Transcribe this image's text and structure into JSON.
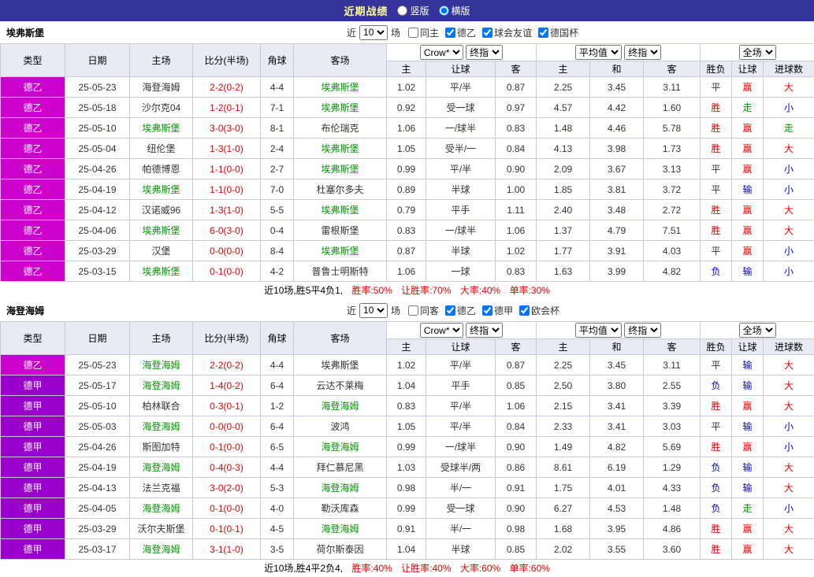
{
  "colors": {
    "red": "#e60000",
    "blue": "#0000cc",
    "green": "#009900",
    "dark": "#333333",
    "focus_team": "#009900",
    "score": "#e60000",
    "topbar_bg": "#333399",
    "header_bg": "#eaeaf5"
  },
  "league_colors": {
    "德乙": "#cc00cc",
    "德甲": "#9900cc"
  },
  "topbar": {
    "title": "近期战绩",
    "views": [
      {
        "label": "竖版",
        "selected": false
      },
      {
        "label": "横版",
        "selected": true
      }
    ]
  },
  "columns": {
    "left": [
      "类型",
      "日期",
      "主场",
      "比分(半场)",
      "角球",
      "客场"
    ],
    "selects": {
      "bookmaker": "Crow*",
      "final_a": "终指",
      "average": "平均值",
      "final_b": "终指",
      "full": "全场"
    },
    "sub": [
      "主",
      "让球",
      "客",
      "主",
      "和",
      "客",
      "胜负",
      "让球",
      "进球数"
    ]
  },
  "sections": [
    {
      "team": "埃弗斯堡",
      "filter": {
        "prefix": "近",
        "count": "10",
        "suffix": "场",
        "checkboxes": [
          {
            "label": "同主",
            "checked": false
          },
          {
            "label": "德乙",
            "checked": true
          },
          {
            "label": "球会友谊",
            "checked": true
          },
          {
            "label": "德国杯",
            "checked": true
          }
        ]
      },
      "rows": [
        {
          "league": "德乙",
          "date": "25-05-23",
          "home": "海登海姆",
          "home_focus": false,
          "score": "2-2(0-2)",
          "corner": "4-4",
          "away": "埃弗斯堡",
          "away_focus": true,
          "odds": [
            "1.02",
            "平/半",
            "0.87"
          ],
          "avg": [
            "2.25",
            "3.45",
            "3.11"
          ],
          "results": [
            [
              "平",
              "dark"
            ],
            [
              "赢",
              "red"
            ],
            [
              "大",
              "red"
            ]
          ]
        },
        {
          "league": "德乙",
          "date": "25-05-18",
          "home": "沙尔克04",
          "home_focus": false,
          "score": "1-2(0-1)",
          "corner": "7-1",
          "away": "埃弗斯堡",
          "away_focus": true,
          "odds": [
            "0.92",
            "受一球",
            "0.97"
          ],
          "avg": [
            "4.57",
            "4.42",
            "1.60"
          ],
          "results": [
            [
              "胜",
              "red"
            ],
            [
              "走",
              "green"
            ],
            [
              "小",
              "blue"
            ]
          ]
        },
        {
          "league": "德乙",
          "date": "25-05-10",
          "home": "埃弗斯堡",
          "home_focus": true,
          "score": "3-0(3-0)",
          "corner": "8-1",
          "away": "布伦瑞克",
          "away_focus": false,
          "odds": [
            "1.06",
            "一/球半",
            "0.83"
          ],
          "avg": [
            "1.48",
            "4.46",
            "5.78"
          ],
          "results": [
            [
              "胜",
              "red"
            ],
            [
              "赢",
              "red"
            ],
            [
              "走",
              "green"
            ]
          ]
        },
        {
          "league": "德乙",
          "date": "25-05-04",
          "home": "纽伦堡",
          "home_focus": false,
          "score": "1-3(1-0)",
          "corner": "2-4",
          "away": "埃弗斯堡",
          "away_focus": true,
          "odds": [
            "1.05",
            "受半/一",
            "0.84"
          ],
          "avg": [
            "4.13",
            "3.98",
            "1.73"
          ],
          "results": [
            [
              "胜",
              "red"
            ],
            [
              "赢",
              "red"
            ],
            [
              "大",
              "red"
            ]
          ]
        },
        {
          "league": "德乙",
          "date": "25-04-26",
          "home": "帕德博恩",
          "home_focus": false,
          "score": "1-1(0-0)",
          "corner": "2-7",
          "away": "埃弗斯堡",
          "away_focus": true,
          "odds": [
            "0.99",
            "平/半",
            "0.90"
          ],
          "avg": [
            "2.09",
            "3.67",
            "3.13"
          ],
          "results": [
            [
              "平",
              "dark"
            ],
            [
              "赢",
              "red"
            ],
            [
              "小",
              "blue"
            ]
          ]
        },
        {
          "league": "德乙",
          "date": "25-04-19",
          "home": "埃弗斯堡",
          "home_focus": true,
          "score": "1-1(0-0)",
          "corner": "7-0",
          "away": "杜塞尔多夫",
          "away_focus": false,
          "odds": [
            "0.89",
            "半球",
            "1.00"
          ],
          "avg": [
            "1.85",
            "3.81",
            "3.72"
          ],
          "results": [
            [
              "平",
              "dark"
            ],
            [
              "输",
              "blue"
            ],
            [
              "小",
              "blue"
            ]
          ]
        },
        {
          "league": "德乙",
          "date": "25-04-12",
          "home": "汉诺威96",
          "home_focus": false,
          "score": "1-3(1-0)",
          "corner": "5-5",
          "away": "埃弗斯堡",
          "away_focus": true,
          "odds": [
            "0.79",
            "平手",
            "1.11"
          ],
          "avg": [
            "2.40",
            "3.48",
            "2.72"
          ],
          "results": [
            [
              "胜",
              "red"
            ],
            [
              "赢",
              "red"
            ],
            [
              "大",
              "red"
            ]
          ]
        },
        {
          "league": "德乙",
          "date": "25-04-06",
          "home": "埃弗斯堡",
          "home_focus": true,
          "score": "6-0(3-0)",
          "corner": "0-4",
          "away": "雷根斯堡",
          "away_focus": false,
          "odds": [
            "0.83",
            "一/球半",
            "1.06"
          ],
          "avg": [
            "1.37",
            "4.79",
            "7.51"
          ],
          "results": [
            [
              "胜",
              "red"
            ],
            [
              "赢",
              "red"
            ],
            [
              "大",
              "red"
            ]
          ]
        },
        {
          "league": "德乙",
          "date": "25-03-29",
          "home": "汉堡",
          "home_focus": false,
          "score": "0-0(0-0)",
          "corner": "8-4",
          "away": "埃弗斯堡",
          "away_focus": true,
          "odds": [
            "0.87",
            "半球",
            "1.02"
          ],
          "avg": [
            "1.77",
            "3.91",
            "4.03"
          ],
          "results": [
            [
              "平",
              "dark"
            ],
            [
              "赢",
              "red"
            ],
            [
              "小",
              "blue"
            ]
          ]
        },
        {
          "league": "德乙",
          "date": "25-03-15",
          "home": "埃弗斯堡",
          "home_focus": true,
          "score": "0-1(0-0)",
          "corner": "4-2",
          "away": "普鲁士明斯特",
          "away_focus": false,
          "odds": [
            "1.06",
            "一球",
            "0.83"
          ],
          "avg": [
            "1.63",
            "3.99",
            "4.82"
          ],
          "results": [
            [
              "负",
              "blue"
            ],
            [
              "输",
              "blue"
            ],
            [
              "小",
              "blue"
            ]
          ]
        }
      ],
      "summary": {
        "prefix": "近10场,胜5平4负1,",
        "stats": [
          "胜率:50%",
          "让胜率:70%",
          "大率:40%",
          "单率:30%"
        ]
      }
    },
    {
      "team": "海登海姆",
      "filter": {
        "prefix": "近",
        "count": "10",
        "suffix": "场",
        "checkboxes": [
          {
            "label": "同客",
            "checked": false
          },
          {
            "label": "德乙",
            "checked": true
          },
          {
            "label": "德甲",
            "checked": true
          },
          {
            "label": "欧会杯",
            "checked": true
          }
        ]
      },
      "rows": [
        {
          "league": "德乙",
          "date": "25-05-23",
          "home": "海登海姆",
          "home_focus": true,
          "score": "2-2(0-2)",
          "corner": "4-4",
          "away": "埃弗斯堡",
          "away_focus": false,
          "odds": [
            "1.02",
            "平/半",
            "0.87"
          ],
          "avg": [
            "2.25",
            "3.45",
            "3.11"
          ],
          "results": [
            [
              "平",
              "dark"
            ],
            [
              "输",
              "blue"
            ],
            [
              "大",
              "red"
            ]
          ]
        },
        {
          "league": "德甲",
          "date": "25-05-17",
          "home": "海登海姆",
          "home_focus": true,
          "score": "1-4(0-2)",
          "corner": "6-4",
          "away": "云达不莱梅",
          "away_focus": false,
          "odds": [
            "1.04",
            "平手",
            "0.85"
          ],
          "avg": [
            "2.50",
            "3.80",
            "2.55"
          ],
          "results": [
            [
              "负",
              "blue"
            ],
            [
              "输",
              "blue"
            ],
            [
              "大",
              "red"
            ]
          ]
        },
        {
          "league": "德甲",
          "date": "25-05-10",
          "home": "柏林联合",
          "home_focus": false,
          "score": "0-3(0-1)",
          "corner": "1-2",
          "away": "海登海姆",
          "away_focus": true,
          "odds": [
            "0.83",
            "平/半",
            "1.06"
          ],
          "avg": [
            "2.15",
            "3.41",
            "3.39"
          ],
          "results": [
            [
              "胜",
              "red"
            ],
            [
              "赢",
              "red"
            ],
            [
              "大",
              "red"
            ]
          ]
        },
        {
          "league": "德甲",
          "date": "25-05-03",
          "home": "海登海姆",
          "home_focus": true,
          "score": "0-0(0-0)",
          "corner": "6-4",
          "away": "波鸿",
          "away_focus": false,
          "odds": [
            "1.05",
            "平/半",
            "0.84"
          ],
          "avg": [
            "2.33",
            "3.41",
            "3.03"
          ],
          "results": [
            [
              "平",
              "dark"
            ],
            [
              "输",
              "blue"
            ],
            [
              "小",
              "blue"
            ]
          ]
        },
        {
          "league": "德甲",
          "date": "25-04-26",
          "home": "斯图加特",
          "home_focus": false,
          "score": "0-1(0-0)",
          "corner": "6-5",
          "away": "海登海姆",
          "away_focus": true,
          "odds": [
            "0.99",
            "一/球半",
            "0.90"
          ],
          "avg": [
            "1.49",
            "4.82",
            "5.69"
          ],
          "results": [
            [
              "胜",
              "red"
            ],
            [
              "赢",
              "red"
            ],
            [
              "小",
              "blue"
            ]
          ]
        },
        {
          "league": "德甲",
          "date": "25-04-19",
          "home": "海登海姆",
          "home_focus": true,
          "score": "0-4(0-3)",
          "corner": "4-4",
          "away": "拜仁慕尼黑",
          "away_focus": false,
          "odds": [
            "1.03",
            "受球半/两",
            "0.86"
          ],
          "avg": [
            "8.61",
            "6.19",
            "1.29"
          ],
          "results": [
            [
              "负",
              "blue"
            ],
            [
              "输",
              "blue"
            ],
            [
              "大",
              "red"
            ]
          ]
        },
        {
          "league": "德甲",
          "date": "25-04-13",
          "home": "法兰克福",
          "home_focus": false,
          "score": "3-0(2-0)",
          "corner": "5-3",
          "away": "海登海姆",
          "away_focus": true,
          "odds": [
            "0.98",
            "半/一",
            "0.91"
          ],
          "avg": [
            "1.75",
            "4.01",
            "4.33"
          ],
          "results": [
            [
              "负",
              "blue"
            ],
            [
              "输",
              "blue"
            ],
            [
              "大",
              "red"
            ]
          ]
        },
        {
          "league": "德甲",
          "date": "25-04-05",
          "home": "海登海姆",
          "home_focus": true,
          "score": "0-1(0-0)",
          "corner": "4-0",
          "away": "勒沃库森",
          "away_focus": false,
          "odds": [
            "0.99",
            "受一球",
            "0.90"
          ],
          "avg": [
            "6.27",
            "4.53",
            "1.48"
          ],
          "results": [
            [
              "负",
              "blue"
            ],
            [
              "走",
              "green"
            ],
            [
              "小",
              "blue"
            ]
          ]
        },
        {
          "league": "德甲",
          "date": "25-03-29",
          "home": "沃尔夫斯堡",
          "home_focus": false,
          "score": "0-1(0-1)",
          "corner": "4-5",
          "away": "海登海姆",
          "away_focus": true,
          "odds": [
            "0.91",
            "半/一",
            "0.98"
          ],
          "avg": [
            "1.68",
            "3.95",
            "4.86"
          ],
          "results": [
            [
              "胜",
              "red"
            ],
            [
              "赢",
              "red"
            ],
            [
              "大",
              "red"
            ]
          ]
        },
        {
          "league": "德甲",
          "date": "25-03-17",
          "home": "海登海姆",
          "home_focus": true,
          "score": "3-1(1-0)",
          "corner": "3-5",
          "away": "荷尔斯泰因",
          "away_focus": false,
          "odds": [
            "1.04",
            "半球",
            "0.85"
          ],
          "avg": [
            "2.02",
            "3.55",
            "3.60"
          ],
          "results": [
            [
              "胜",
              "red"
            ],
            [
              "赢",
              "red"
            ],
            [
              "大",
              "red"
            ]
          ]
        }
      ],
      "summary": {
        "prefix": "近10场,胜4平2负4,",
        "stats": [
          "胜率:40%",
          "让胜率:40%",
          "大率:60%",
          "单率:60%"
        ]
      }
    }
  ]
}
